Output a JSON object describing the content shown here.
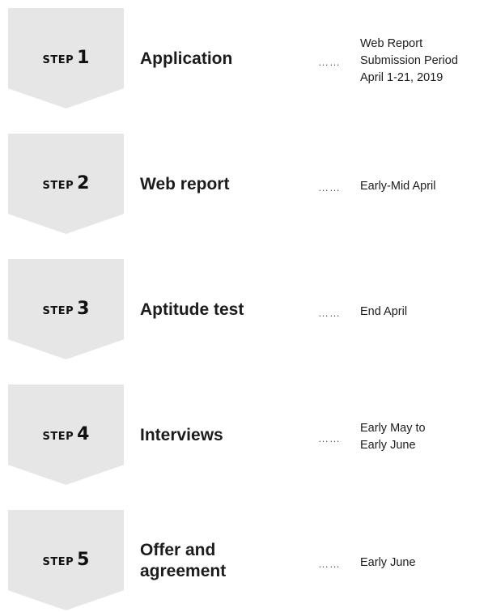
{
  "steps": [
    {
      "word": "STEP",
      "number": "1",
      "title": [
        "Application"
      ],
      "dots": "……",
      "note": [
        "Web Report",
        "Submission Period",
        "April 1-21, 2019"
      ]
    },
    {
      "word": "STEP",
      "number": "2",
      "title": [
        "Web report"
      ],
      "dots": "……",
      "note": [
        "Early-Mid April"
      ]
    },
    {
      "word": "STEP",
      "number": "3",
      "title": [
        "Aptitude test"
      ],
      "dots": "……",
      "note": [
        "End April"
      ]
    },
    {
      "word": "STEP",
      "number": "4",
      "title": [
        "Interviews"
      ],
      "dots": "……",
      "note": [
        "Early May to",
        "Early June"
      ]
    },
    {
      "word": "STEP",
      "number": "5",
      "title": [
        "Offer and",
        "agreement"
      ],
      "dots": "……",
      "note": [
        "Early June"
      ]
    }
  ],
  "colors": {
    "chevron": "#e6e6e6",
    "text": "#1c1c1c"
  }
}
